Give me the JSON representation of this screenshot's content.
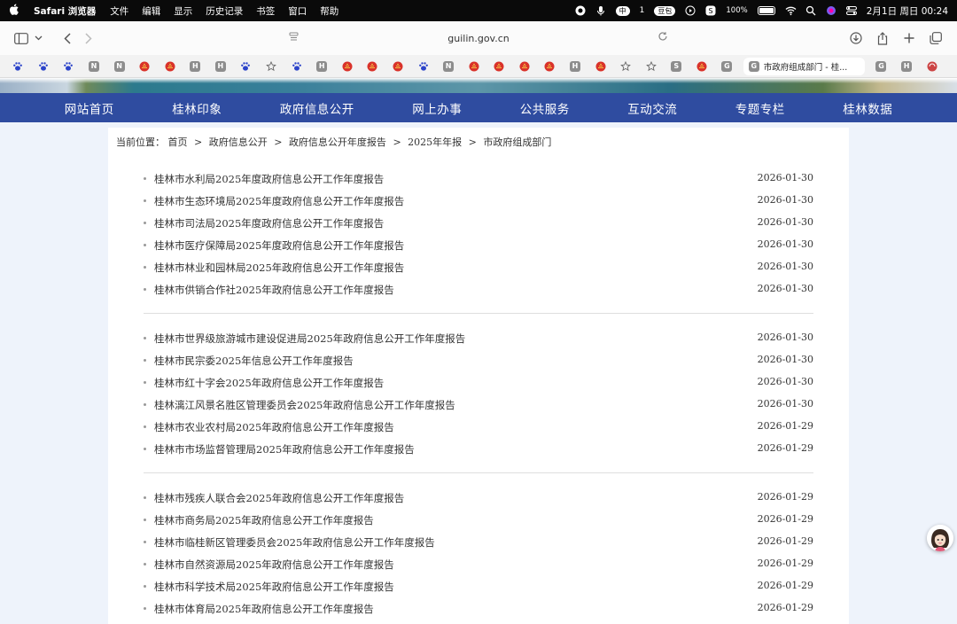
{
  "menubar": {
    "app_name": "Safari 浏览器",
    "items": [
      "文件",
      "编辑",
      "显示",
      "历史记录",
      "书签",
      "窗口",
      "帮助"
    ],
    "ime_label": "中",
    "notification_count": "1",
    "douban_label": "豆包",
    "battery": "100%",
    "datetime": "2月1日 周日  00:24"
  },
  "toolbar": {
    "url": "guilin.gov.cn"
  },
  "tabs": {
    "active_title": "市政府组成部门 - 桂...",
    "favicons": [
      "paw",
      "paw",
      "paw",
      "N",
      "N",
      "emblem",
      "emblem",
      "H",
      "H",
      "paw",
      "star",
      "paw",
      "H",
      "emblem",
      "emblem",
      "emblem",
      "paw",
      "N",
      "emblem",
      "emblem",
      "emblem",
      "emblem",
      "H",
      "emblem",
      "star",
      "star",
      "S",
      "emblem",
      "G"
    ],
    "after_active": [
      "G",
      "H",
      "swirl"
    ]
  },
  "nav": {
    "items": [
      "网站首页",
      "桂林印象",
      "政府信息公开",
      "网上办事",
      "公共服务",
      "互动交流",
      "专题专栏",
      "桂林数据"
    ]
  },
  "breadcrumb": {
    "label": "当前位置：",
    "items": [
      "首页",
      "政府信息公开",
      "政府信息公开年度报告",
      "2025年年报",
      "市政府组成部门"
    ],
    "separator": ">"
  },
  "report_groups": [
    [
      {
        "title": "桂林市水利局2025年度政府信息公开工作年度报告",
        "date": "2026-01-30"
      },
      {
        "title": "桂林市生态环境局2025年度政府信息公开工作年度报告",
        "date": "2026-01-30"
      },
      {
        "title": "桂林市司法局2025年度政府信息公开工作年度报告",
        "date": "2026-01-30"
      },
      {
        "title": "桂林市医疗保障局2025年度政府信息公开工作年度报告",
        "date": "2026-01-30"
      },
      {
        "title": "桂林市林业和园林局2025年政府信息公开工作年度报告",
        "date": "2026-01-30"
      },
      {
        "title": "桂林市供销合作社2025年政府信息公开工作年度报告",
        "date": "2026-01-30"
      }
    ],
    [
      {
        "title": "桂林市世界级旅游城市建设促进局2025年政府信息公开工作年度报告",
        "date": "2026-01-30"
      },
      {
        "title": "桂林市民宗委2025年信息公开工作年度报告",
        "date": "2026-01-30"
      },
      {
        "title": "桂林市红十字会2025年政府信息公开工作年度报告",
        "date": "2026-01-30"
      },
      {
        "title": "桂林漓江风景名胜区管理委员会2025年政府信息公开工作年度报告",
        "date": "2026-01-30"
      },
      {
        "title": "桂林市农业农村局2025年政府信息公开工作年度报告",
        "date": "2026-01-29"
      },
      {
        "title": "桂林市市场监督管理局2025年政府信息公开工作年度报告",
        "date": "2026-01-29"
      }
    ],
    [
      {
        "title": "桂林市残疾人联合会2025年政府信息公开工作年度报告",
        "date": "2026-01-29"
      },
      {
        "title": "桂林市商务局2025年政府信息公开工作年度报告",
        "date": "2026-01-29"
      },
      {
        "title": "桂林市临桂新区管理委员会2025年政府信息公开工作年度报告",
        "date": "2026-01-29"
      },
      {
        "title": "桂林市自然资源局2025年政府信息公开工作年度报告",
        "date": "2026-01-29"
      },
      {
        "title": "桂林市科学技术局2025年政府信息公开工作年度报告",
        "date": "2026-01-29"
      },
      {
        "title": "桂林市体育局2025年政府信息公开工作年度报告",
        "date": "2026-01-29"
      }
    ]
  ],
  "colors": {
    "nav_bg": "#2f4ca0",
    "page_bg": "#eef3fb",
    "menubar_bg": "#0a0a0a"
  }
}
